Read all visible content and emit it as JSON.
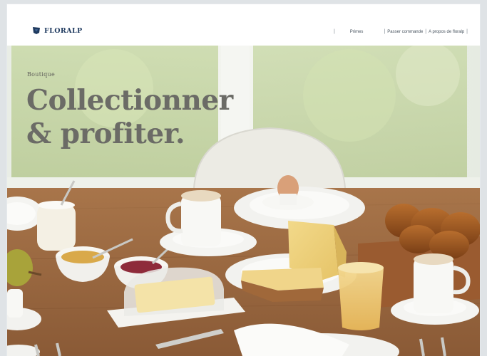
{
  "brand": {
    "name": "FLORALP",
    "logo_icon": "floralp-flag-icon",
    "color": "#1f3a5f"
  },
  "nav": {
    "separator": "|",
    "items": [
      {
        "label": "Primes"
      },
      {
        "label": "Passer commande"
      },
      {
        "label": "A propos de floralp"
      }
    ]
  },
  "hero": {
    "kicker": "Boutique",
    "headline_line1": "Collectionner",
    "headline_line2": "& profiter."
  }
}
